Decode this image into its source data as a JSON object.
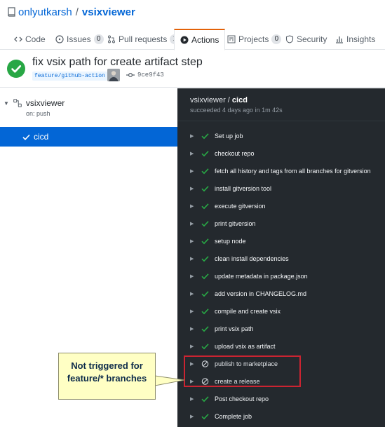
{
  "repo": {
    "owner": "onlyutkarsh",
    "separator": "/",
    "name": "vsixviewer"
  },
  "tabs": [
    {
      "label": "Code",
      "count": null,
      "icon": "code-icon"
    },
    {
      "label": "Issues",
      "count": "0",
      "icon": "issue-icon"
    },
    {
      "label": "Pull requests",
      "count": "1",
      "icon": "pull-request-icon"
    },
    {
      "label": "Actions",
      "count": null,
      "icon": "play-icon",
      "active": true
    },
    {
      "label": "Projects",
      "count": "0",
      "icon": "project-icon"
    },
    {
      "label": "Security",
      "count": null,
      "icon": "shield-icon"
    },
    {
      "label": "Insights",
      "count": null,
      "icon": "graph-icon"
    }
  ],
  "commit": {
    "title": "fix vsix path for create artifact step",
    "branch": "feature/github-action",
    "sha": "9ce9f43"
  },
  "workflow": {
    "name": "vsixviewer",
    "trigger": "on: push"
  },
  "job": {
    "name": "cicd"
  },
  "log": {
    "workflow": "vsixviewer",
    "separator": " / ",
    "job": "cicd",
    "status": "succeeded 4 days ago in 1m 42s"
  },
  "steps": [
    {
      "label": "Set up job",
      "state": "success"
    },
    {
      "label": "checkout repo",
      "state": "success"
    },
    {
      "label": "fetch all history and tags from all branches for gitversion",
      "state": "success"
    },
    {
      "label": "install gitversion tool",
      "state": "success"
    },
    {
      "label": "execute gitversion",
      "state": "success"
    },
    {
      "label": "print gitversion",
      "state": "success"
    },
    {
      "label": "setup node",
      "state": "success"
    },
    {
      "label": "clean install dependencies",
      "state": "success"
    },
    {
      "label": "update metadata in package.json",
      "state": "success"
    },
    {
      "label": "add version in CHANGELOG.md",
      "state": "success"
    },
    {
      "label": "compile and create vsix",
      "state": "success"
    },
    {
      "label": "print vsix path",
      "state": "success"
    },
    {
      "label": "upload vsix as artifact",
      "state": "success"
    },
    {
      "label": "publish to marketplace",
      "state": "skipped"
    },
    {
      "label": "create a release",
      "state": "skipped"
    },
    {
      "label": "Post checkout repo",
      "state": "success"
    },
    {
      "label": "Complete job",
      "state": "success"
    }
  ],
  "callout": {
    "line1": "Not triggered for",
    "line2": "feature/* branches"
  },
  "colors": {
    "success": "#28a745",
    "link": "#0366d6",
    "log_bg": "#24292e",
    "active_tab": "#e36209",
    "highlight": "#cb2431",
    "callout_bg": "#ffffc4"
  }
}
